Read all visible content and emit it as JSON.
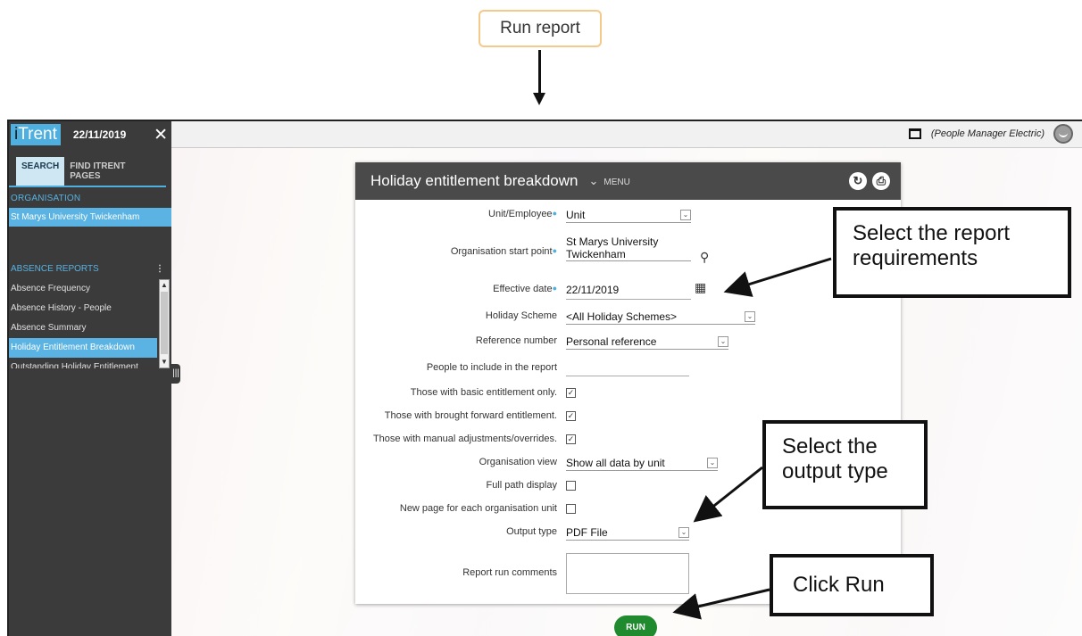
{
  "callouts": {
    "run_report": "Run report",
    "select_requirements_line1": "Select the report",
    "select_requirements_line2": "requirements",
    "select_output_line1": "Select the",
    "select_output_line2": "output type",
    "click_run": "Click Run"
  },
  "sidebar": {
    "logo_i": "i",
    "logo_trent": "Trent",
    "date": "22/11/2019",
    "close": "✕",
    "tabs": [
      {
        "label": "SEARCH"
      },
      {
        "label": "FIND ITRENT PAGES"
      }
    ],
    "organisation_label": "ORGANISATION",
    "organisation_value": "St Marys University Twickenham",
    "absence_reports_label": "ABSENCE REPORTS",
    "reports": [
      {
        "label": "Absence Frequency"
      },
      {
        "label": "Absence History - People"
      },
      {
        "label": "Absence Summary"
      },
      {
        "label": "Holiday Entitlement Breakdown"
      },
      {
        "label": "Outstanding Holiday Entitlement"
      }
    ]
  },
  "topbar": {
    "user": "(People Manager Electric)"
  },
  "panel": {
    "title": "Holiday entitlement breakdown",
    "menu": "MENU",
    "fields": {
      "unit_employee": {
        "label": "Unit/Employee",
        "value": "Unit"
      },
      "org_start": {
        "label": "Organisation start point",
        "value_line1": "St Marys University",
        "value_line2": "Twickenham"
      },
      "effective_date": {
        "label": "Effective date",
        "value": "22/11/2019"
      },
      "holiday_scheme": {
        "label": "Holiday Scheme",
        "value": "<All Holiday Schemes>"
      },
      "reference_number": {
        "label": "Reference number",
        "value": "Personal reference"
      },
      "people_include": {
        "label": "People to include in the report",
        "value": ""
      },
      "basic_entitlement": {
        "label": "Those with basic entitlement only.",
        "checked": true
      },
      "brought_forward": {
        "label": "Those with brought forward entitlement.",
        "checked": true
      },
      "manual_adjust": {
        "label": "Those with manual adjustments/overrides.",
        "checked": true
      },
      "org_view": {
        "label": "Organisation view",
        "value": "Show all data by unit"
      },
      "full_path": {
        "label": "Full path display",
        "checked": false
      },
      "new_page": {
        "label": "New page for each organisation unit",
        "checked": false
      },
      "output_type": {
        "label": "Output type",
        "value": "PDF File"
      },
      "comments": {
        "label": "Report run comments",
        "value": ""
      }
    },
    "run_label": "RUN"
  }
}
